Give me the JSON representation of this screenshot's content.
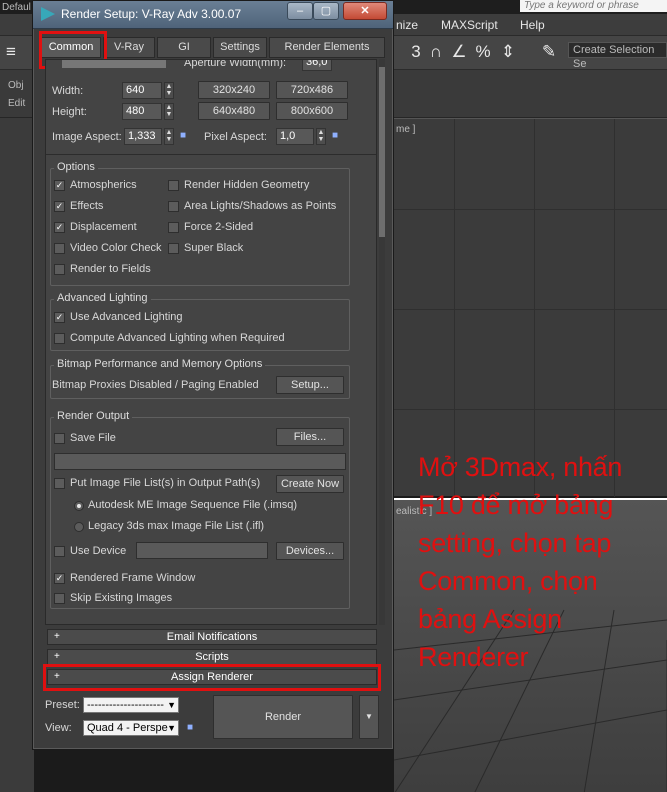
{
  "background": {
    "search_placeholder": "Type a keyword or phrase",
    "menu": [
      "nize",
      "MAXScript",
      "Help"
    ],
    "create_selection_set": "Create Selection Se",
    "left_labels": [
      "Defaul",
      "Obj",
      "Edit"
    ],
    "viewport_label_top": "me ]",
    "viewport_label_bottom": "ealistic ]",
    "toolbar_num": "3"
  },
  "dialog": {
    "title": "Render Setup: V-Ray Adv 3.00.07",
    "window_buttons": {
      "minimize": "‒",
      "maximize": "▢",
      "close": "✕"
    },
    "tabs": [
      "Common",
      "V-Ray",
      "GI",
      "Settings",
      "Render Elements"
    ],
    "active_tab": "Common",
    "output_size": {
      "aperture_label": "Aperture Width(mm):",
      "aperture_value": "36,0",
      "width_label": "Width:",
      "width_value": "640",
      "height_label": "Height:",
      "height_value": "480",
      "presets": [
        "320x240",
        "720x486",
        "640x480",
        "800x600"
      ],
      "image_aspect_label": "Image Aspect:",
      "image_aspect_value": "1,333",
      "pixel_aspect_label": "Pixel Aspect:",
      "pixel_aspect_value": "1,0"
    },
    "options": {
      "title": "Options",
      "left": [
        {
          "label": "Atmospherics",
          "checked": true
        },
        {
          "label": "Effects",
          "checked": true
        },
        {
          "label": "Displacement",
          "checked": true
        },
        {
          "label": "Video Color Check",
          "checked": false
        },
        {
          "label": "Render to Fields",
          "checked": false
        }
      ],
      "right": [
        {
          "label": "Render Hidden Geometry",
          "checked": false
        },
        {
          "label": "Area Lights/Shadows as Points",
          "checked": false
        },
        {
          "label": "Force 2-Sided",
          "checked": false
        },
        {
          "label": "Super Black",
          "checked": false
        }
      ]
    },
    "advanced_lighting": {
      "title": "Advanced Lighting",
      "use": "Use Advanced Lighting",
      "use_checked": true,
      "compute": "Compute Advanced Lighting when Required",
      "compute_checked": false
    },
    "bitmap": {
      "title": "Bitmap Performance and Memory Options",
      "status": "Bitmap Proxies Disabled / Paging Enabled",
      "setup_button": "Setup..."
    },
    "render_output": {
      "title": "Render Output",
      "save_file": "Save File",
      "files_button": "Files...",
      "put_image": "Put Image File List(s) in Output Path(s)",
      "create_now": "Create Now",
      "autodesk": "Autodesk ME Image Sequence File (.imsq)",
      "legacy": "Legacy 3ds max Image File List (.ifl)",
      "use_device": "Use Device",
      "devices_button": "Devices...",
      "rendered_frame": "Rendered Frame Window",
      "rendered_frame_checked": true,
      "skip_existing": "Skip Existing Images"
    },
    "rollouts": [
      "Email Notifications",
      "Scripts",
      "Assign Renderer"
    ],
    "preset_label": "Preset:",
    "preset_value": "---------------------",
    "view_label": "View:",
    "view_value": "Quad 4 - Perspe",
    "render_button": "Render"
  },
  "annotation": "Mở 3Dmax, nhấn F10 để mở bảng setting, chọn tap Common, chọn bảng Assign Renderer",
  "colors": {
    "highlight": "#e01010",
    "annotation": "#e01010"
  }
}
